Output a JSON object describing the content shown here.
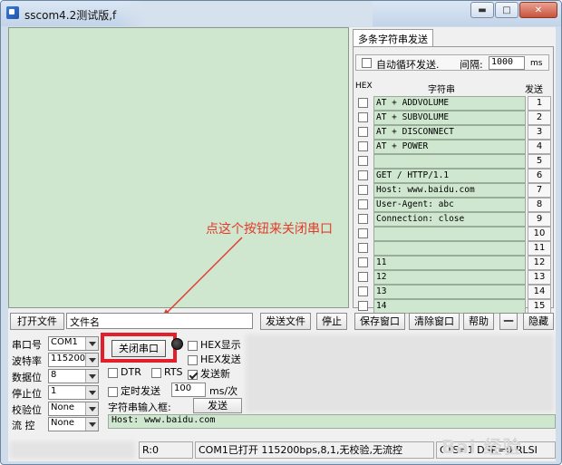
{
  "window": {
    "title": "sscom4.2测试版,f",
    "controls": [
      "minimize-icon",
      "maximize-icon",
      "close-icon"
    ]
  },
  "annotation": {
    "text": "点这个按钮来关闭串口",
    "color": "#e33a2b"
  },
  "multi_send": {
    "tab_label": "多条字符串发送",
    "loop_label": "自动循环发送.",
    "interval_label": "间隔:",
    "interval_value": "1000",
    "interval_unit": "ms",
    "header_hex": "HEX",
    "header_string": "字符串",
    "header_send": "发送",
    "rows": [
      {
        "text": "AT + ADDVOLUME",
        "btn": "1"
      },
      {
        "text": "AT + SUBVOLUME",
        "btn": "2"
      },
      {
        "text": "AT + DISCONNECT",
        "btn": "3"
      },
      {
        "text": "AT + POWER",
        "btn": "4"
      },
      {
        "text": "",
        "btn": "5"
      },
      {
        "text": "GET / HTTP/1.1",
        "btn": "6"
      },
      {
        "text": "Host: www.baidu.com",
        "btn": "7"
      },
      {
        "text": "User-Agent: abc",
        "btn": "8"
      },
      {
        "text": "Connection: close",
        "btn": "9"
      },
      {
        "text": "",
        "btn": "10"
      },
      {
        "text": "",
        "btn": "11"
      },
      {
        "text": "11",
        "btn": "12"
      },
      {
        "text": "12",
        "btn": "13"
      },
      {
        "text": "13",
        "btn": "14"
      },
      {
        "text": "14",
        "btn": "15"
      }
    ]
  },
  "file_row": {
    "open_file": "打开文件",
    "file_name": "文件名",
    "send_file": "发送文件",
    "stop": "停止",
    "save_window": "保存窗口",
    "clear_window": "清除窗口",
    "help": "帮助",
    "dash": "一",
    "hide": "隐藏"
  },
  "settings": {
    "port_label": "串口号",
    "port_value": "COM1",
    "baud_label": "波特率",
    "baud_value": "115200",
    "databits_label": "数据位",
    "databits_value": "8",
    "stopbits_label": "停止位",
    "stopbits_value": "1",
    "parity_label": "校验位",
    "parity_value": "None",
    "flow_label": "流 控",
    "flow_value": "None",
    "close_port": "关闭串口",
    "hex_display": "HEX显示",
    "hex_send": "HEX发送",
    "dtr": "DTR",
    "rts": "RTS",
    "send_newline": "发送新",
    "timed_send": "定时发送",
    "timed_value": "100",
    "timed_unit": "ms/次",
    "input_label": "字符串输入框:",
    "send": "发送",
    "input_value": "Host: www.baidu.com"
  },
  "status": {
    "rx": "R:0",
    "port_info": "COM1已打开  115200bps,8,1,无校验,无流控",
    "signals": "CTS=1 DSR=0 RLSI"
  },
  "watermark": "Bai 经验"
}
